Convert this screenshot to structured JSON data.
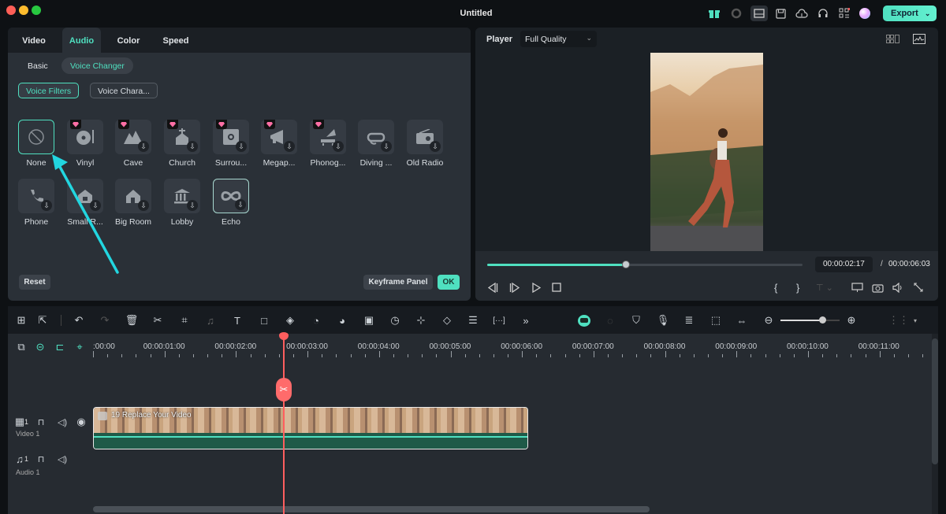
{
  "window": {
    "title": "Untitled",
    "export_label": "Export",
    "top_icons": [
      "gift-icon",
      "record-icon",
      "layout-icon",
      "save-icon",
      "cloud-upload-icon",
      "headset-icon",
      "apps-grid-icon",
      "avatar-icon"
    ]
  },
  "property_panel": {
    "tabs": [
      {
        "label": "Video",
        "active": false
      },
      {
        "label": "Audio",
        "active": true
      },
      {
        "label": "Color",
        "active": false
      },
      {
        "label": "Speed",
        "active": false
      }
    ],
    "subtabs": [
      {
        "label": "Basic",
        "active": false
      },
      {
        "label": "Voice Changer",
        "active": true
      }
    ],
    "filter_pills": [
      {
        "label": "Voice Filters",
        "active": true
      },
      {
        "label": "Voice Chara...",
        "active": false
      }
    ],
    "effects": [
      {
        "label": "None",
        "icon": "none-icon",
        "selected": true,
        "premium": false,
        "download": false
      },
      {
        "label": "Vinyl",
        "icon": "vinyl-icon",
        "selected": false,
        "premium": true,
        "download": false
      },
      {
        "label": "Cave",
        "icon": "cave-icon",
        "selected": false,
        "premium": true,
        "download": true
      },
      {
        "label": "Church",
        "icon": "church-icon",
        "selected": false,
        "premium": true,
        "download": true
      },
      {
        "label": "Surrou...",
        "icon": "surround-icon",
        "selected": false,
        "premium": true,
        "download": true
      },
      {
        "label": "Megap...",
        "icon": "megaphone-icon",
        "selected": false,
        "premium": true,
        "download": true
      },
      {
        "label": "Phonog...",
        "icon": "phonograph-icon",
        "selected": false,
        "premium": true,
        "download": true
      },
      {
        "label": "Diving ...",
        "icon": "diving-mask-icon",
        "selected": false,
        "premium": false,
        "download": true
      },
      {
        "label": "Old Radio",
        "icon": "radio-icon",
        "selected": false,
        "premium": false,
        "download": true
      },
      {
        "label": "Phone",
        "icon": "phone-icon",
        "selected": false,
        "premium": false,
        "download": true
      },
      {
        "label": "Small R...",
        "icon": "small-room-icon",
        "selected": false,
        "premium": false,
        "download": true
      },
      {
        "label": "Big Room",
        "icon": "big-room-icon",
        "selected": false,
        "premium": false,
        "download": true
      },
      {
        "label": "Lobby",
        "icon": "lobby-icon",
        "selected": false,
        "premium": false,
        "download": true
      },
      {
        "label": "Echo",
        "icon": "echo-icon",
        "selected": false,
        "premium": false,
        "download": true,
        "hover": true
      }
    ],
    "reset_label": "Reset",
    "keyframe_label": "Keyframe Panel",
    "ok_label": "OK"
  },
  "player": {
    "label": "Player",
    "quality": "Full Quality",
    "current_time": "00:00:02:17",
    "separator": "/",
    "total_time": "00:00:06:03",
    "progress_fraction": 0.44
  },
  "toolbar": {
    "left_icons": [
      "multi-layout-icon",
      "select-tool-icon",
      "undo-icon",
      "redo-icon",
      "delete-icon",
      "cut-icon",
      "crop-icon",
      "audio-detach-icon",
      "text-icon",
      "shape-icon",
      "mask-icon",
      "speed-icon",
      "color-icon",
      "pip-icon",
      "timer-icon",
      "zoom-fit-icon",
      "keyframe-icon",
      "adjust-icon",
      "more-code-icon",
      "more-icon"
    ],
    "right_icons": [
      "ai-robot-icon",
      "render-preview-icon",
      "marker-icon",
      "mic-icon",
      "playlist-icon",
      "preview-window-icon",
      "fit-timeline-icon",
      "zoom-out-icon",
      "zoom-in-icon",
      "track-layout-icon"
    ],
    "zoom_fraction": 0.7
  },
  "timeline": {
    "ruler_labels": [
      ":00:00",
      "00:00:01:00",
      "00:00:02:00",
      "00:00:03:00",
      "00:00:04:00",
      "00:00:05:00",
      "00:00:06:00",
      "00:00:07:00",
      "00:00:08:00",
      "00:00:09:00",
      "00:00:10:00",
      "00:00:11:00"
    ],
    "header_icons": [
      "add-track-icon",
      "link-icon",
      "ripple-icon",
      "snap-icon"
    ],
    "tracks": [
      {
        "name": "Video 1",
        "index": "1",
        "type": "video"
      },
      {
        "name": "Audio 1",
        "index": "1",
        "type": "audio"
      }
    ],
    "clip": {
      "title": "19 Replace Your Video"
    }
  }
}
